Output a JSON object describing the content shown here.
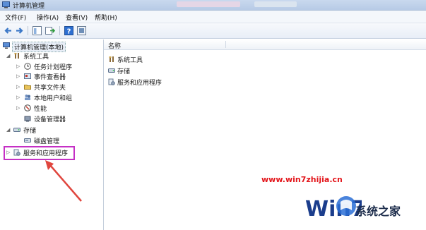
{
  "window": {
    "title": "计算机管理"
  },
  "menu": [
    "文件(F)",
    "操作(A)",
    "查看(V)",
    "帮助(H)"
  ],
  "toolbar": {
    "buttons": [
      "back-arrow-icon",
      "forward-arrow-icon",
      "console-tree-icon",
      "export-list-icon",
      "help-icon",
      "properties-icon"
    ]
  },
  "tree": {
    "root": "计算机管理(本地)",
    "items": [
      {
        "label": "系统工具",
        "level": 1,
        "expander": "expanded",
        "icon": "tools-icon"
      },
      {
        "label": "任务计划程序",
        "level": 2,
        "expander": "collapsed",
        "icon": "clock-icon"
      },
      {
        "label": "事件查看器",
        "level": 2,
        "expander": "collapsed",
        "icon": "event-viewer-icon"
      },
      {
        "label": "共享文件夹",
        "level": 2,
        "expander": "collapsed",
        "icon": "shared-folder-icon"
      },
      {
        "label": "本地用户和组",
        "level": 2,
        "expander": "collapsed",
        "icon": "users-icon"
      },
      {
        "label": "性能",
        "level": 2,
        "expander": "collapsed",
        "icon": "performance-icon"
      },
      {
        "label": "设备管理器",
        "level": 2,
        "expander": "none",
        "icon": "device-manager-icon"
      },
      {
        "label": "存储",
        "level": 1,
        "expander": "expanded",
        "icon": "storage-icon"
      },
      {
        "label": "磁盘管理",
        "level": 2,
        "expander": "none",
        "icon": "disk-icon"
      },
      {
        "label": "服务和应用程序",
        "level": 1,
        "expander": "collapsed",
        "icon": "services-icon",
        "highlighted": true
      }
    ]
  },
  "list": {
    "column_header": "名称",
    "items": [
      {
        "label": "系统工具",
        "icon": "tools-icon"
      },
      {
        "label": "存储",
        "icon": "storage-icon"
      },
      {
        "label": "服务和应用程序",
        "icon": "services-icon"
      }
    ]
  },
  "watermark": {
    "url": "www.win7zhijia.cn",
    "brand": "系统之家",
    "logo_letters": "Win7"
  },
  "colors": {
    "highlight_border": "#c530c5",
    "annotation_arrow": "#e0463e",
    "watermark_url": "#e3161b"
  }
}
